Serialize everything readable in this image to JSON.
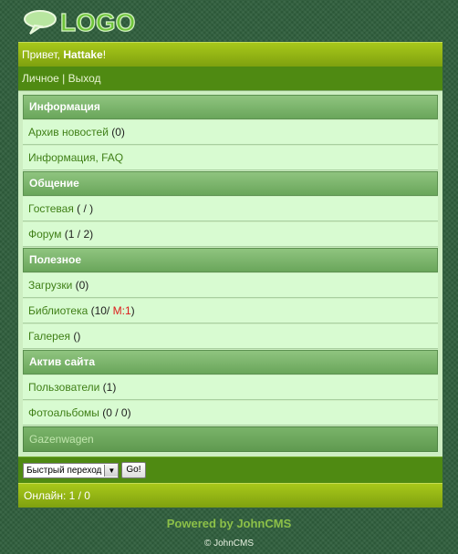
{
  "logo": {
    "text": "LOGO",
    "color": "#6fc43a"
  },
  "greeting": {
    "prefix": "Привет, ",
    "username": "Hattake",
    "suffix": "!"
  },
  "topnav": {
    "personal": "Личное",
    "separator": " | ",
    "logout": "Выход"
  },
  "sections": [
    {
      "title": "Информация",
      "items": [
        {
          "link": "Архив новостей",
          "extra": " (0)"
        },
        {
          "link": "Информация, FAQ",
          "extra": ""
        }
      ]
    },
    {
      "title": "Общение",
      "items": [
        {
          "link": "Гостевая",
          "extra": " ( / )"
        },
        {
          "link": "Форум",
          "extra": " (1 / 2)"
        }
      ]
    },
    {
      "title": "Полезное",
      "items": [
        {
          "link": "Загрузки",
          "extra": " (0)"
        },
        {
          "link": "Библиотека",
          "extra_pre": " (10/ ",
          "extra_red": "M:1",
          "extra_post": ")"
        },
        {
          "link": "Галерея",
          "extra": " ()"
        }
      ]
    },
    {
      "title": "Актив сайта",
      "items": [
        {
          "link": "Пользователи",
          "extra": " (1)"
        },
        {
          "link": "Фотоальбомы",
          "extra": " (0 / 0)"
        }
      ]
    }
  ],
  "last_item": "Gazenwagen",
  "quick_jump": {
    "selected": "Быстрый переход",
    "button": "Go!"
  },
  "online": "Онлайн: 1 / 0",
  "footer": {
    "powered": "Powered by JohnCMS",
    "copyright": "© JohnCMS"
  }
}
